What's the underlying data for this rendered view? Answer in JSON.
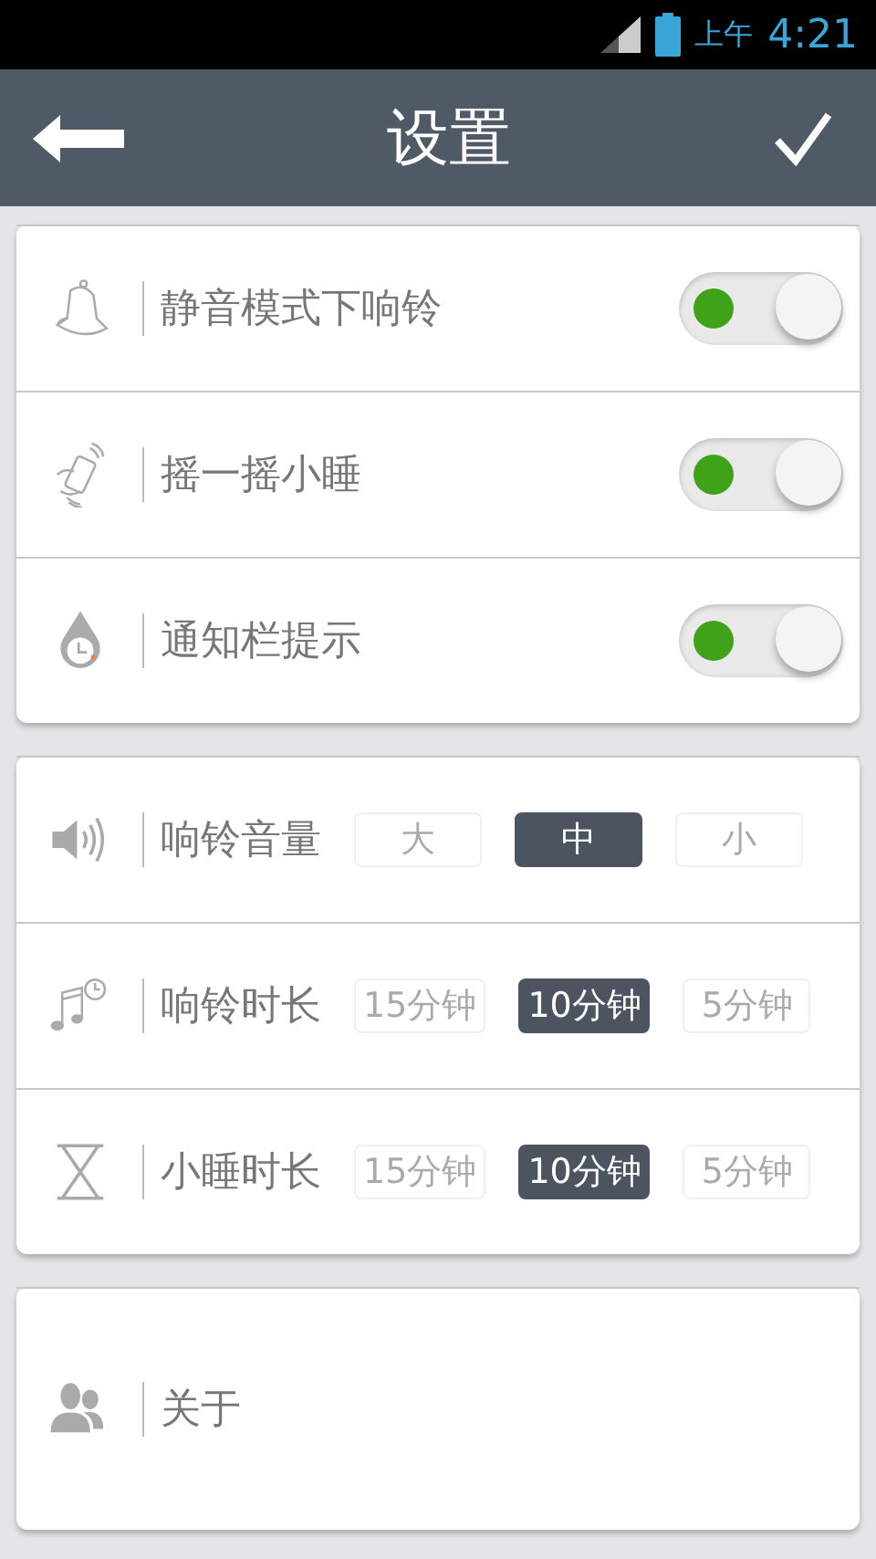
{
  "status_bar": {
    "period": "上午",
    "time": "4:21"
  },
  "header": {
    "title": "设置"
  },
  "sections": [
    {
      "rows": [
        {
          "kind": "toggle",
          "label": "静音模式下响铃",
          "on": true
        },
        {
          "kind": "toggle",
          "label": "摇一摇小睡",
          "on": true
        },
        {
          "kind": "toggle",
          "label": "通知栏提示",
          "on": true
        }
      ]
    },
    {
      "rows": [
        {
          "kind": "choice",
          "label": "响铃音量",
          "options": [
            {
              "label": "大",
              "selected": false
            },
            {
              "label": "中",
              "selected": true
            },
            {
              "label": "小",
              "selected": false
            }
          ]
        },
        {
          "kind": "choice",
          "label": "响铃时长",
          "options": [
            {
              "label": "15分钟",
              "selected": false
            },
            {
              "label": "10分钟",
              "selected": true
            },
            {
              "label": "5分钟",
              "selected": false
            }
          ]
        },
        {
          "kind": "choice",
          "label": "小睡时长",
          "options": [
            {
              "label": "15分钟",
              "selected": false
            },
            {
              "label": "10分钟",
              "selected": true
            },
            {
              "label": "5分钟",
              "selected": false
            }
          ]
        }
      ]
    },
    {
      "rows": [
        {
          "kind": "link",
          "label": "关于"
        }
      ]
    }
  ]
}
